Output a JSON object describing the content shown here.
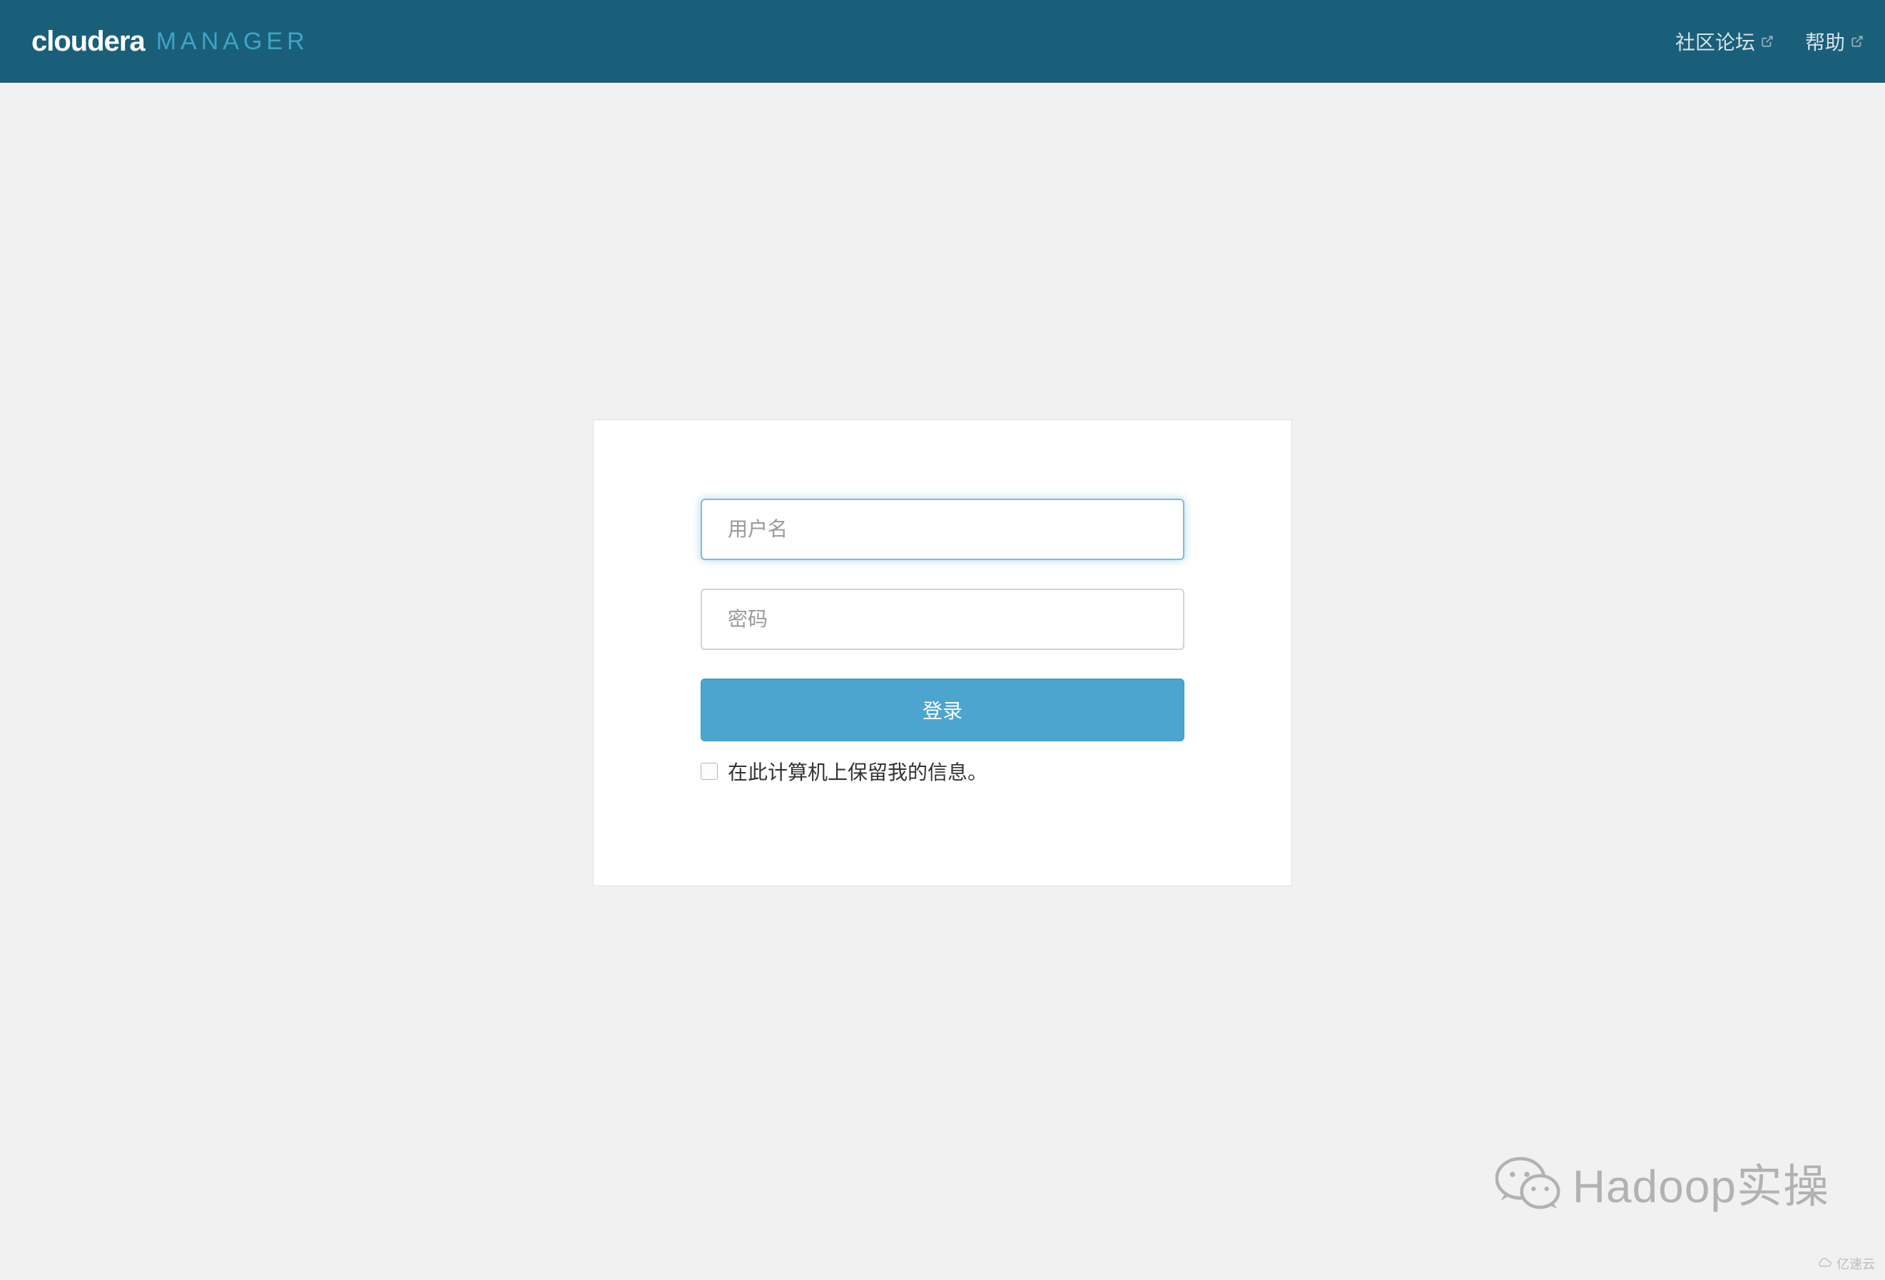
{
  "header": {
    "logo_brand": "cloudera",
    "logo_product": "MANAGER",
    "community_link": "社区论坛",
    "help_link": "帮助"
  },
  "login": {
    "username_placeholder": "用户名",
    "password_placeholder": "密码",
    "login_button": "登录",
    "remember_label": "在此计算机上保留我的信息。"
  },
  "watermark": {
    "main_text": "Hadoop实操",
    "small_text": "亿速云"
  }
}
